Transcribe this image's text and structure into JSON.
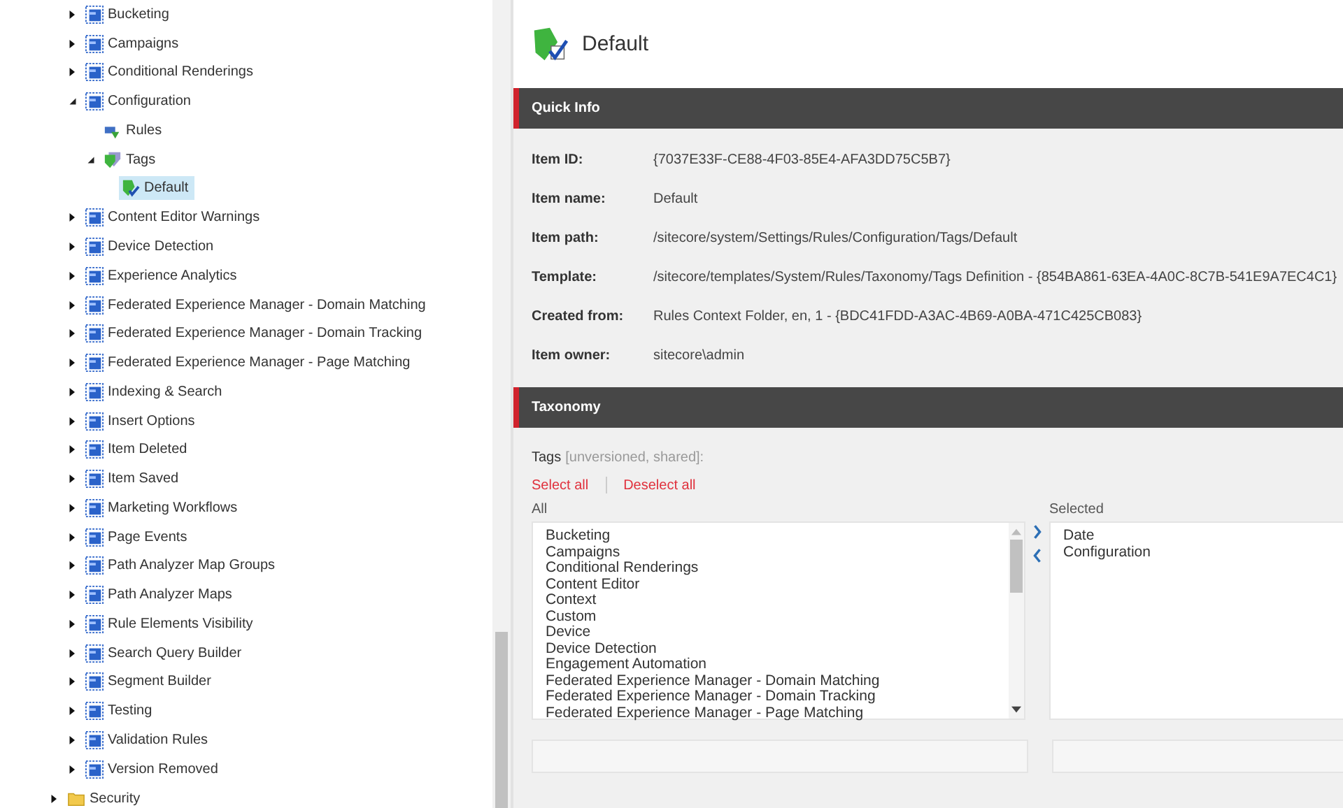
{
  "tree": {
    "items": [
      {
        "label": "Bucketing",
        "kind": "item",
        "expanded": false,
        "selected": false
      },
      {
        "label": "Campaigns",
        "kind": "item",
        "expanded": false,
        "selected": false
      },
      {
        "label": "Conditional Renderings",
        "kind": "item",
        "expanded": false,
        "selected": false
      },
      {
        "label": "Configuration",
        "kind": "item",
        "expanded": true,
        "selected": false,
        "children": [
          {
            "label": "Rules",
            "kind": "rules",
            "selected": false
          },
          {
            "label": "Tags",
            "kind": "tags",
            "expanded": true,
            "selected": false,
            "children": [
              {
                "label": "Default",
                "kind": "tag",
                "selected": true
              }
            ]
          }
        ]
      },
      {
        "label": "Content Editor Warnings",
        "kind": "item",
        "expanded": false,
        "selected": false
      },
      {
        "label": "Device Detection",
        "kind": "item",
        "expanded": false,
        "selected": false
      },
      {
        "label": "Experience Analytics",
        "kind": "item",
        "expanded": false,
        "selected": false
      },
      {
        "label": "Federated Experience Manager - Domain Matching",
        "kind": "item",
        "expanded": false,
        "selected": false
      },
      {
        "label": "Federated Experience Manager - Domain Tracking",
        "kind": "item",
        "expanded": false,
        "selected": false
      },
      {
        "label": "Federated Experience Manager - Page Matching",
        "kind": "item",
        "expanded": false,
        "selected": false
      },
      {
        "label": "Indexing & Search",
        "kind": "item",
        "expanded": false,
        "selected": false
      },
      {
        "label": "Insert Options",
        "kind": "item",
        "expanded": false,
        "selected": false
      },
      {
        "label": "Item Deleted",
        "kind": "item",
        "expanded": false,
        "selected": false
      },
      {
        "label": "Item Saved",
        "kind": "item",
        "expanded": false,
        "selected": false
      },
      {
        "label": "Marketing Workflows",
        "kind": "item",
        "expanded": false,
        "selected": false
      },
      {
        "label": "Page Events",
        "kind": "item",
        "expanded": false,
        "selected": false
      },
      {
        "label": "Path Analyzer Map Groups",
        "kind": "item",
        "expanded": false,
        "selected": false
      },
      {
        "label": "Path Analyzer Maps",
        "kind": "item",
        "expanded": false,
        "selected": false
      },
      {
        "label": "Rule Elements Visibility",
        "kind": "item",
        "expanded": false,
        "selected": false
      },
      {
        "label": "Search Query Builder",
        "kind": "item",
        "expanded": false,
        "selected": false
      },
      {
        "label": "Segment Builder",
        "kind": "item",
        "expanded": false,
        "selected": false
      },
      {
        "label": "Testing",
        "kind": "item",
        "expanded": false,
        "selected": false
      },
      {
        "label": "Validation Rules",
        "kind": "item",
        "expanded": false,
        "selected": false
      },
      {
        "label": "Version Removed",
        "kind": "item",
        "expanded": false,
        "selected": false
      }
    ],
    "outer_items": [
      {
        "label": "Security",
        "kind": "folder",
        "expanded": false,
        "selected": false
      }
    ]
  },
  "header": {
    "title": "Default"
  },
  "quick_info": {
    "title": "Quick Info",
    "fields": [
      {
        "label": "Item ID:",
        "value": "{7037E33F-CE88-4F03-85E4-AFA3DD75C5B7}"
      },
      {
        "label": "Item name:",
        "value": "Default"
      },
      {
        "label": "Item path:",
        "value": "/sitecore/system/Settings/Rules/Configuration/Tags/Default"
      },
      {
        "label": "Template:",
        "value": "/sitecore/templates/System/Rules/Taxonomy/Tags Definition - {854BA861-63EA-4A0C-8C7B-541E9A7EC4C1}"
      },
      {
        "label": "Created from:",
        "value": "Rules Context Folder, en, 1 - {BDC41FDD-A3AC-4B69-A0BA-471C425CB083}"
      },
      {
        "label": "Item owner:",
        "value": "sitecore\\admin"
      }
    ]
  },
  "taxonomy": {
    "title": "Taxonomy",
    "field_label": "Tags",
    "field_note": "[unversioned, shared]:",
    "links": [
      "Select all",
      "Deselect all"
    ],
    "all_label": "All",
    "selected_label": "Selected",
    "all_items": [
      "Bucketing",
      "Campaigns",
      "Conditional Renderings",
      "Content Editor",
      "Context",
      "Custom",
      "Device",
      "Device Detection",
      "Engagement Automation",
      "Federated Experience Manager - Domain Matching",
      "Federated Experience Manager - Domain Tracking",
      "Federated Experience Manager - Page Matching"
    ],
    "selected_items": [
      "Date",
      "Configuration"
    ]
  }
}
